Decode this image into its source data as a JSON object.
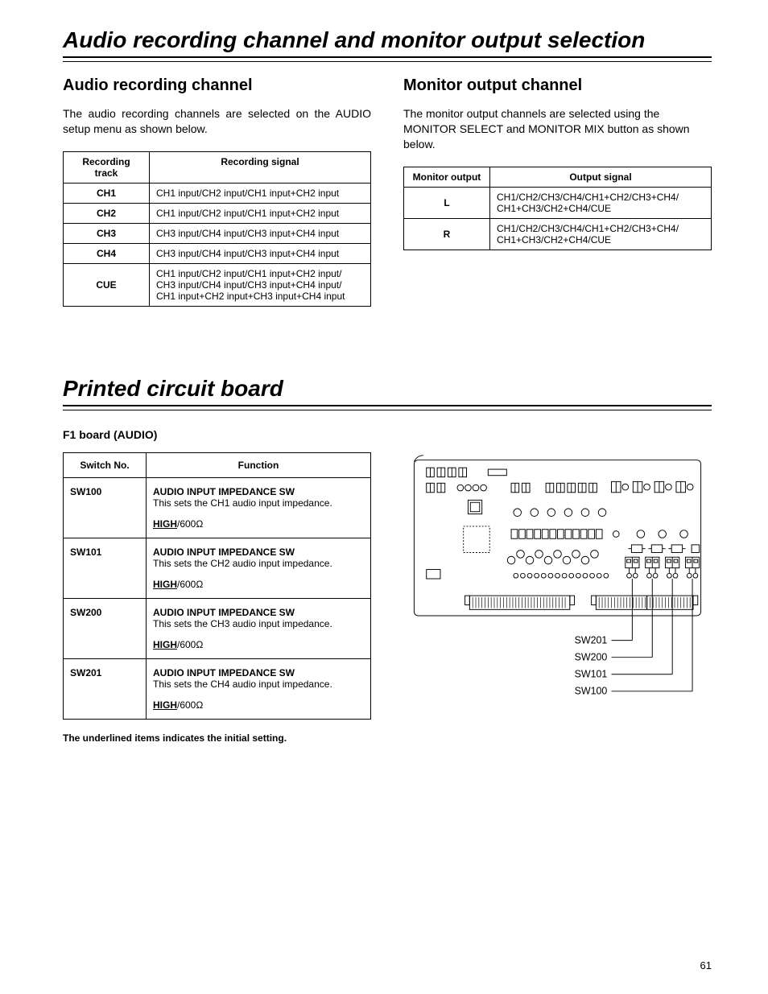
{
  "title1": "Audio recording channel and monitor output selection",
  "audio": {
    "heading": "Audio recording channel",
    "para": "The audio recording channels are selected on the AUDIO setup menu as shown below.",
    "th1": "Recording track",
    "th2": "Recording signal",
    "rows": [
      {
        "track": "CH1",
        "sig": "CH1 input/CH2 input/CH1 input+CH2 input"
      },
      {
        "track": "CH2",
        "sig": "CH1 input/CH2 input/CH1 input+CH2 input"
      },
      {
        "track": "CH3",
        "sig": "CH3 input/CH4 input/CH3 input+CH4 input"
      },
      {
        "track": "CH4",
        "sig": "CH3 input/CH4 input/CH3  input+CH4 input"
      },
      {
        "track": "CUE",
        "sig": "CH1 input/CH2 input/CH1 input+CH2 input/\nCH3 input/CH4 input/CH3 input+CH4 input/\nCH1 input+CH2 input+CH3 input+CH4 input"
      }
    ]
  },
  "monitor": {
    "heading": "Monitor output channel",
    "para": "The monitor output channels are selected using the MONITOR SELECT and MONITOR MIX button as shown below.",
    "th1": "Monitor output",
    "th2": "Output signal",
    "rows": [
      {
        "out": "L",
        "sig": "CH1/CH2/CH3/CH4/CH1+CH2/CH3+CH4/\nCH1+CH3/CH2+CH4/CUE"
      },
      {
        "out": "R",
        "sig": "CH1/CH2/CH3/CH4/CH1+CH2/CH3+CH4/\nCH1+CH3/CH2+CH4/CUE"
      }
    ]
  },
  "title2": "Printed circuit board",
  "f1heading": "F1 board (AUDIO)",
  "swth1": "Switch No.",
  "swth2": "Function",
  "switches": [
    {
      "no": "SW100",
      "head": "AUDIO INPUT IMPEDANCE SW",
      "desc": "This sets the CH1 audio input impedance.",
      "s1": "HIGH",
      "s2": "/600Ω"
    },
    {
      "no": "SW101",
      "head": "AUDIO INPUT IMPEDANCE SW",
      "desc": "This sets the CH2 audio input impedance.",
      "s1": "HIGH",
      "s2": "/600Ω"
    },
    {
      "no": "SW200",
      "head": "AUDIO INPUT IMPEDANCE SW",
      "desc": "This sets the CH3 audio input impedance.",
      "s1": "HIGH",
      "s2": "/600Ω"
    },
    {
      "no": "SW201",
      "head": "AUDIO INPUT IMPEDANCE SW",
      "desc": "This sets the CH4 audio input impedance.",
      "s1": "HIGH",
      "s2": "/600Ω"
    }
  ],
  "note": "The underlined items indicates the initial setting.",
  "pcb_labels": {
    "a": "SW201",
    "b": "SW200",
    "c": "SW101",
    "d": "SW100"
  },
  "pagenum": "61"
}
